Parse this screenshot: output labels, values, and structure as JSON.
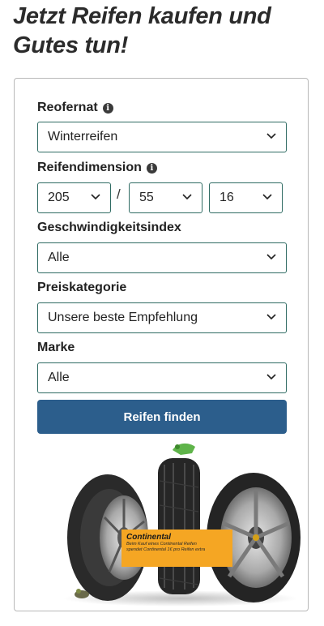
{
  "headline": "Jetzt Reifen kaufen und Gutes tun!",
  "form": {
    "season": {
      "label": "Reofernat",
      "value": "Winterreifen"
    },
    "dimension": {
      "label": "Reifendimension",
      "width": "205",
      "height": "55",
      "rim": "16",
      "separator": "/"
    },
    "speed_index": {
      "label": "Geschwindigkeitsindex",
      "value": "Alle"
    },
    "price_category": {
      "label": "Preiskategorie",
      "value": "Unsere beste Empfehlung"
    },
    "brand": {
      "label": "Marke",
      "value": "Alle"
    },
    "submit_label": "Reifen finden"
  },
  "promo": {
    "brand": "Continental",
    "text_line1": "Beim Kauf eines Continental Reifen",
    "text_line2": "spendet Continental 1€ pro Reifen extra"
  },
  "colors": {
    "accent": "#2c5e8c",
    "border": "#2f6b63",
    "badge": "#f5a623"
  },
  "icons": {
    "info": "info-icon",
    "dropdown": "chevron-down-icon"
  }
}
